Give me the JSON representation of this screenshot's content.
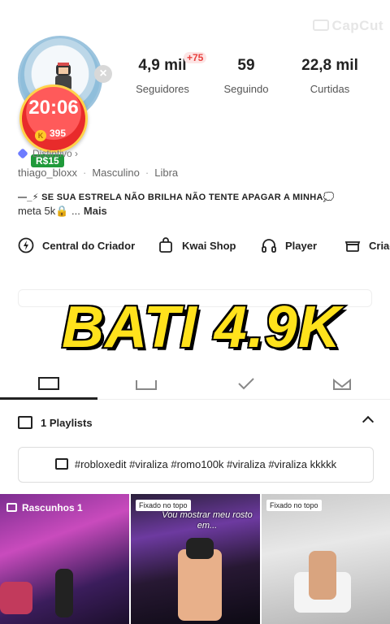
{
  "watermark": "CapCut",
  "avatar": {
    "timer": "20:06",
    "coins": "395",
    "reais": "R$15"
  },
  "stats": [
    {
      "value": "4,9 mil",
      "label": "Seguidores",
      "badge": "+75"
    },
    {
      "value": "59",
      "label": "Seguindo"
    },
    {
      "value": "22,8 mil",
      "label": "Curtidas"
    }
  ],
  "verify": "Distintivo",
  "meta": {
    "username": "thiago_bloxx",
    "gender": "Masculino",
    "sign": "Libra"
  },
  "bio": {
    "line1": "—_⚡ SE SUA ESTRELA NÃO BRILHA NÃO TENTE APAGAR A MINHA💭",
    "line2": "meta 5k🔒 ...",
    "more": "Mais"
  },
  "shortcuts": [
    "Central do Criador",
    "Kwai Shop",
    "Player",
    "Criac"
  ],
  "overlay_title": "BATI 4.9K",
  "playlists": {
    "label": "1 Playlists",
    "tags": "#robloxedit #viraliza #romo100k #viraliza #viraliza kkkkk"
  },
  "grid": {
    "drafts": "Rascunhos 1",
    "pinned": "Fixado no topo",
    "caption": "Vou mostrar meu rosto em..."
  },
  "colors": {
    "accent_red": "#e8413f",
    "overlay_yellow": "#ffe21c",
    "timer_red": "#ff5a5a"
  }
}
